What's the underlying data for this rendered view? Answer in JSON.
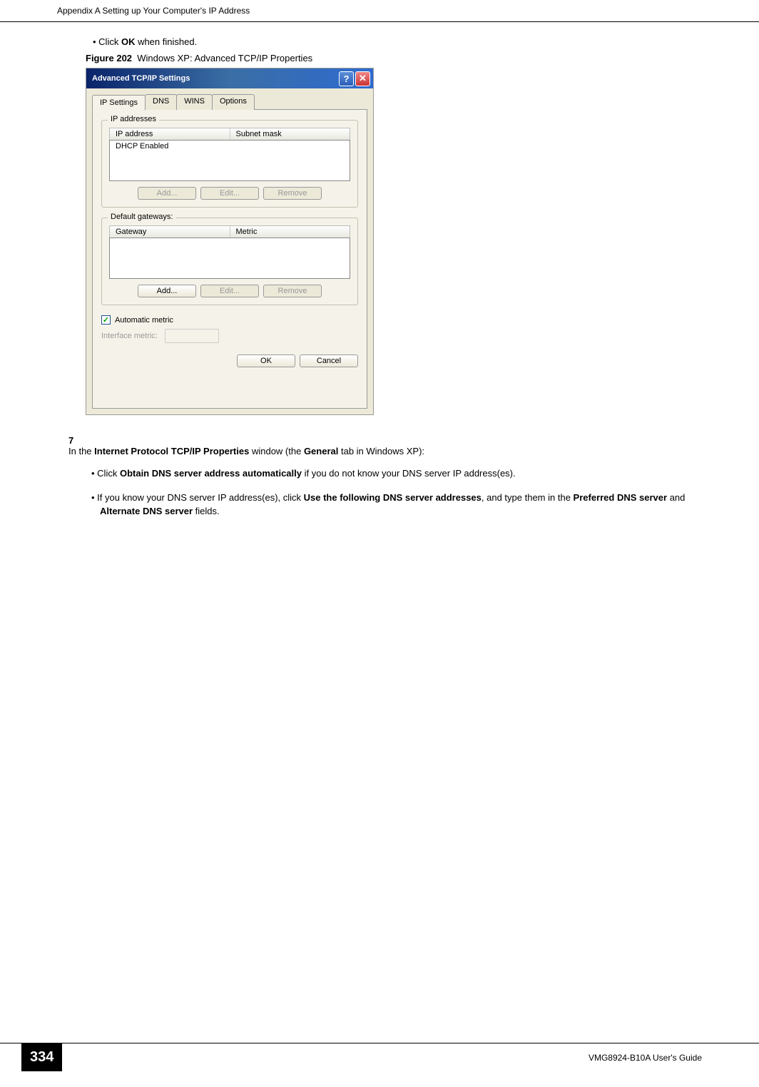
{
  "header": {
    "appendix_title": "Appendix A Setting up Your Computer's IP Address"
  },
  "bullet1": "Click OK when finished.",
  "figure": {
    "label": "Figure 202",
    "caption": "Windows XP: Advanced TCP/IP Properties"
  },
  "dialog": {
    "title": "Advanced TCP/IP Settings",
    "tabs": [
      "IP Settings",
      "DNS",
      "WINS",
      "Options"
    ],
    "group_ip": {
      "title": "IP addresses",
      "col1": "IP address",
      "col2": "Subnet mask",
      "row1": "DHCP Enabled",
      "add": "Add...",
      "edit": "Edit...",
      "remove": "Remove"
    },
    "group_gw": {
      "title": "Default gateways:",
      "col1": "Gateway",
      "col2": "Metric",
      "add": "Add...",
      "edit": "Edit...",
      "remove": "Remove"
    },
    "auto_metric": "Automatic metric",
    "interface_metric": "Interface metric:",
    "ok": "OK",
    "cancel": "Cancel"
  },
  "step7": {
    "number": "7",
    "intro_a": "In the ",
    "intro_b": "Internet Protocol TCP/IP Properties",
    "intro_c": " window (the ",
    "intro_d": "General",
    "intro_e": " tab in Windows XP):",
    "b1_a": "Click ",
    "b1_b": "Obtain DNS server address automatically",
    "b1_c": " if you do not know your DNS server IP address(es).",
    "b2_a": "If you know your DNS server IP address(es), click ",
    "b2_b": "Use the following DNS server addresses",
    "b2_c": ", and type them in the ",
    "b2_d": "Preferred DNS server",
    "b2_e": " and ",
    "b2_f": "Alternate DNS server",
    "b2_g": " fields."
  },
  "footer": {
    "page": "334",
    "guide": "VMG8924-B10A User's Guide"
  }
}
